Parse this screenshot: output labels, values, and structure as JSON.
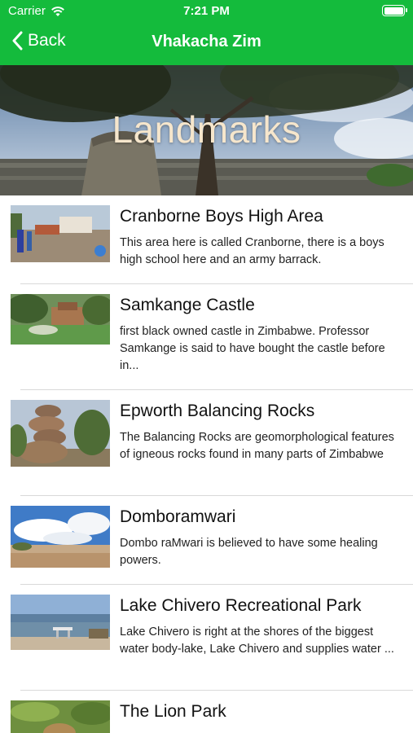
{
  "status_bar": {
    "carrier": "Carrier",
    "time": "7:21 PM"
  },
  "nav": {
    "back_label": "Back",
    "title": "Vhakacha Zim"
  },
  "hero": {
    "title": "Landmarks"
  },
  "colors": {
    "accent": "#14bb3c"
  },
  "landmarks": [
    {
      "title": "Cranborne Boys High Area",
      "description": "This area here is called Cranborne, there is a boys high school here and an army barrack."
    },
    {
      "title": "Samkange Castle",
      "description": "first black owned castle in Zimbabwe. Professor Samkange is said to have bought the castle before in..."
    },
    {
      "title": "Epworth Balancing Rocks",
      "description": "The Balancing Rocks are geomorphological features of igneous rocks found in many parts of Zimbabwe"
    },
    {
      "title": "Domboramwari",
      "description": "Dombo raMwari is believed to have some healing powers."
    },
    {
      "title": "Lake Chivero Recreational Park",
      "description": "Lake Chivero is right at the shores of the biggest water body-lake, Lake Chivero and supplies water ..."
    },
    {
      "title": "The Lion Park",
      "description": ""
    }
  ]
}
